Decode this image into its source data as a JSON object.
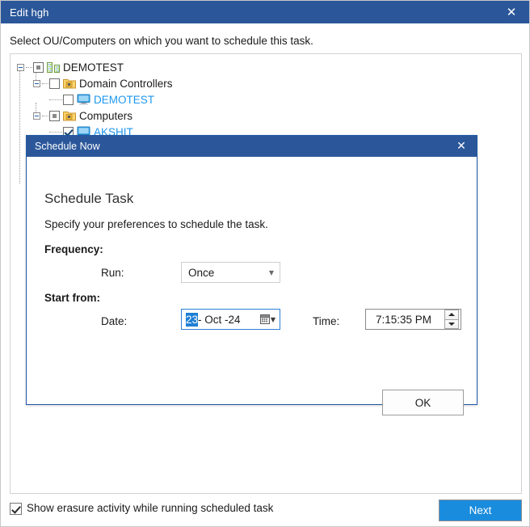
{
  "window": {
    "title": "Edit hgh",
    "close_label": "✕",
    "titlebar_color": "#2b579a"
  },
  "instruction": "Select OU/Computers on which you want to schedule this task.",
  "tree": {
    "nodes": [
      {
        "label": "DEMOTEST",
        "level": 0,
        "checkbox": "partial",
        "icon": "org-building-icon",
        "expander": "minus",
        "link": false
      },
      {
        "label": "Domain Controllers",
        "level": 1,
        "checkbox": "unchecked",
        "icon": "ou-folder-icon",
        "expander": "minus",
        "link": false
      },
      {
        "label": "DEMOTEST",
        "level": 2,
        "checkbox": "unchecked",
        "icon": "computer-monitor-icon",
        "expander": "none",
        "link": true
      },
      {
        "label": "Computers",
        "level": 1,
        "checkbox": "partial",
        "icon": "ou-folder-icon",
        "expander": "minus",
        "link": false
      },
      {
        "label": "AKSHIT",
        "level": 2,
        "checkbox": "checked",
        "icon": "computer-monitor-icon",
        "expander": "none",
        "link": true
      }
    ]
  },
  "modal": {
    "title": "Schedule Now",
    "close_label": "✕",
    "heading": "Schedule Task",
    "subtitle": "Specify your preferences to schedule the task.",
    "frequency_label": "Frequency:",
    "run_label": "Run:",
    "run_value": "Once",
    "run_options": [
      "Once"
    ],
    "start_from_label": "Start from:",
    "date_label": "Date:",
    "date_selected_part": "23",
    "date_rest": "- Oct -24",
    "time_label": "Time:",
    "time_value": "7:15:35 PM",
    "ok_label": "OK"
  },
  "footer": {
    "checkbox_label": "Show erasure activity while running scheduled task",
    "checkbox_checked": true,
    "next_label": "Next",
    "next_color": "#1a8cdd"
  }
}
